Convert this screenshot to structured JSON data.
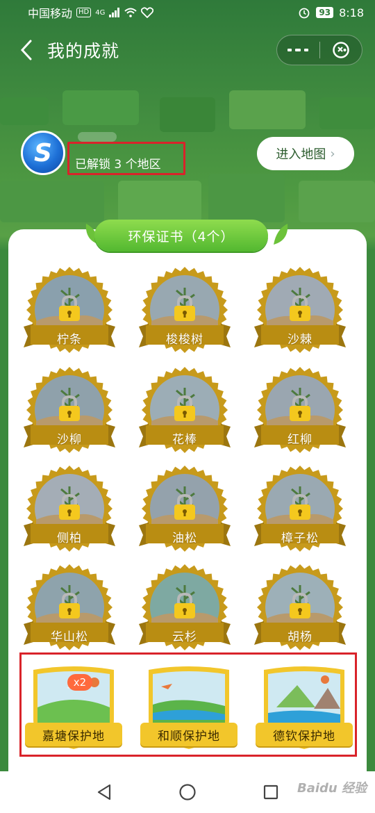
{
  "status_bar": {
    "carrier": "中国移动",
    "hd": "HD",
    "signal": "4G",
    "battery": "93",
    "time": "8:18"
  },
  "nav": {
    "title": "我的成就",
    "more_icon": "more-dots-icon",
    "close_icon": "close-target-icon"
  },
  "user": {
    "unlock_text": "已解锁 3 个地区",
    "enter_map_label": "进入地图",
    "enter_map_chevron": "›"
  },
  "section": {
    "title": "环保证书（4个）"
  },
  "badges": [
    {
      "label": "柠条"
    },
    {
      "label": "梭梭树"
    },
    {
      "label": "沙棘"
    },
    {
      "label": "沙柳"
    },
    {
      "label": "花棒"
    },
    {
      "label": "红柳"
    },
    {
      "label": "侧柏"
    },
    {
      "label": "油松"
    },
    {
      "label": "樟子松"
    },
    {
      "label": "华山松"
    },
    {
      "label": "云杉"
    },
    {
      "label": "胡杨"
    }
  ],
  "reserves": [
    {
      "label": "嘉塘保护地",
      "count": "x2"
    },
    {
      "label": "和顺保护地"
    },
    {
      "label": "德钦保护地"
    }
  ],
  "watermark": "Baidu 经验",
  "colors": {
    "accent_green": "#53b830",
    "badge_gold": "#c79a1b",
    "highlight_red": "#d9232a",
    "lock_yellow": "#f4c81e"
  }
}
